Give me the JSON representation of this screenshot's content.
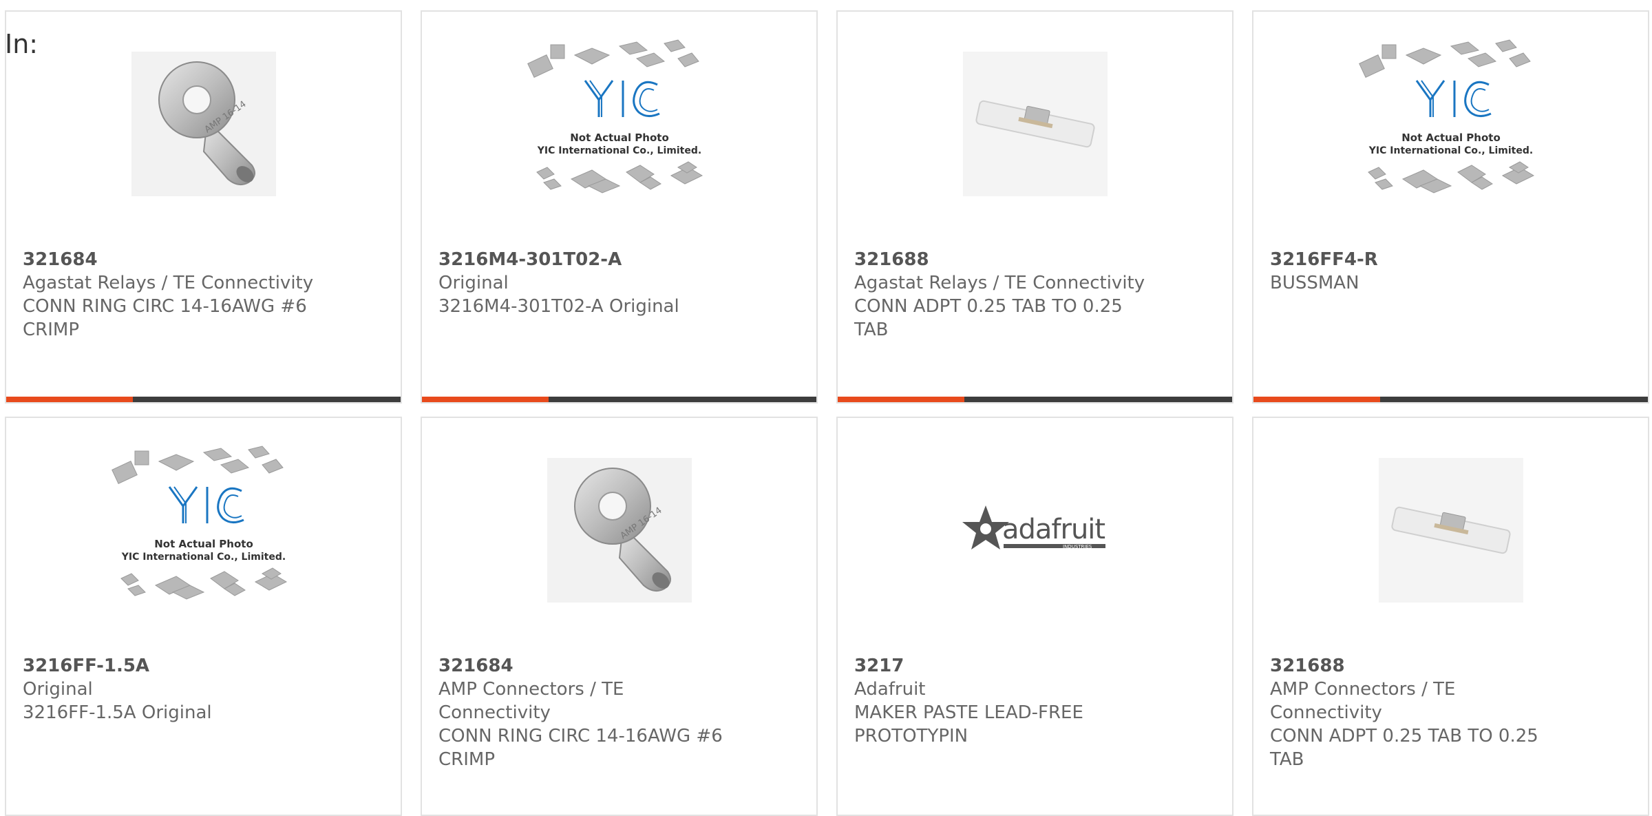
{
  "filter": {
    "label": "In:"
  },
  "colors": {
    "accent": "#e84a1c",
    "bar": "#3d3d3d",
    "yic_blue": "#1a76c2"
  },
  "placeholder": {
    "line1": "Not Actual Photo",
    "line2": "YIC International Co., Limited.",
    "logo": "YIC"
  },
  "brand_logo": {
    "text": "adafruit",
    "subtext": "INDUSTRIES"
  },
  "products": [
    {
      "part": "321684",
      "manufacturer": "Agastat Relays / TE Connectivity",
      "description": [
        "CONN RING CIRC 14-16AWG #6",
        "CRIMP"
      ],
      "image": "ring-terminal-icon",
      "stamp": "AMP 16-14"
    },
    {
      "part": "3216M4-301T02-A",
      "manufacturer": "Original",
      "description": [
        "3216M4-301T02-A Original"
      ],
      "image": "yic-placeholder-icon"
    },
    {
      "part": "321688",
      "manufacturer": "Agastat Relays / TE Connectivity",
      "description": [
        "CONN ADPT 0.25 TAB TO 0.25",
        "TAB"
      ],
      "image": "tab-adapter-icon"
    },
    {
      "part": "3216FF4-R",
      "manufacturer": "BUSSMAN",
      "description": [],
      "image": "yic-placeholder-icon"
    },
    {
      "part": "3216FF-1.5A",
      "manufacturer": "Original",
      "description": [
        "3216FF-1.5A Original"
      ],
      "image": "yic-placeholder-icon"
    },
    {
      "part": "321684",
      "manufacturer": "AMP Connectors / TE Connectivity",
      "description": [
        "CONN RING CIRC 14-16AWG #6",
        "CRIMP"
      ],
      "image": "ring-terminal-icon",
      "stamp": "AMP 16-14"
    },
    {
      "part": "3217",
      "manufacturer": "Adafruit",
      "description": [
        "MAKER PASTE LEAD-FREE",
        "PROTOTYPIN"
      ],
      "image": "adafruit-logo-icon"
    },
    {
      "part": "321688",
      "manufacturer": "AMP Connectors / TE Connectivity",
      "description": [
        "CONN ADPT 0.25 TAB TO 0.25",
        "TAB"
      ],
      "image": "tab-adapter-icon"
    }
  ]
}
